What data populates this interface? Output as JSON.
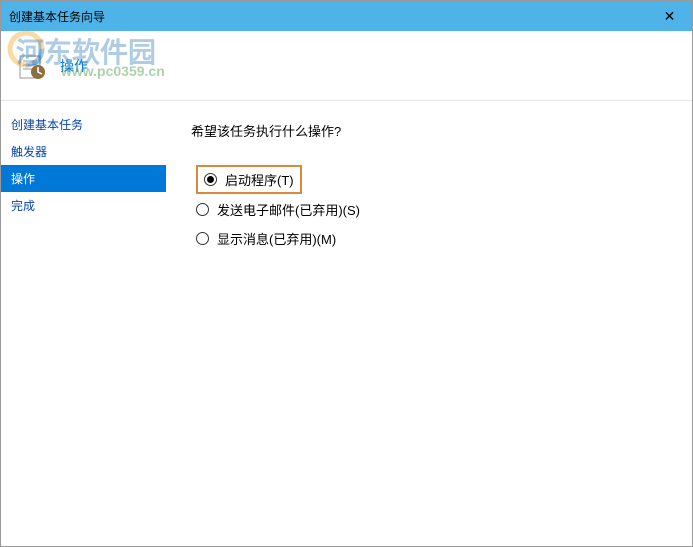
{
  "titlebar": {
    "title": "创建基本任务向导",
    "close": "✕"
  },
  "header": {
    "title": "操作"
  },
  "watermark": {
    "text": "河东软件园",
    "url": "www.pc0359.cn"
  },
  "sidebar": {
    "items": [
      {
        "label": "创建基本任务",
        "active": false
      },
      {
        "label": "触发器",
        "active": false
      },
      {
        "label": "操作",
        "active": true
      },
      {
        "label": "完成",
        "active": false
      }
    ]
  },
  "main": {
    "prompt": "希望该任务执行什么操作?",
    "options": [
      {
        "label": "启动程序(T)",
        "checked": true,
        "highlighted": true
      },
      {
        "label": "发送电子邮件(已弃用)(S)",
        "checked": false,
        "highlighted": false
      },
      {
        "label": "显示消息(已弃用)(M)",
        "checked": false,
        "highlighted": false
      }
    ]
  }
}
